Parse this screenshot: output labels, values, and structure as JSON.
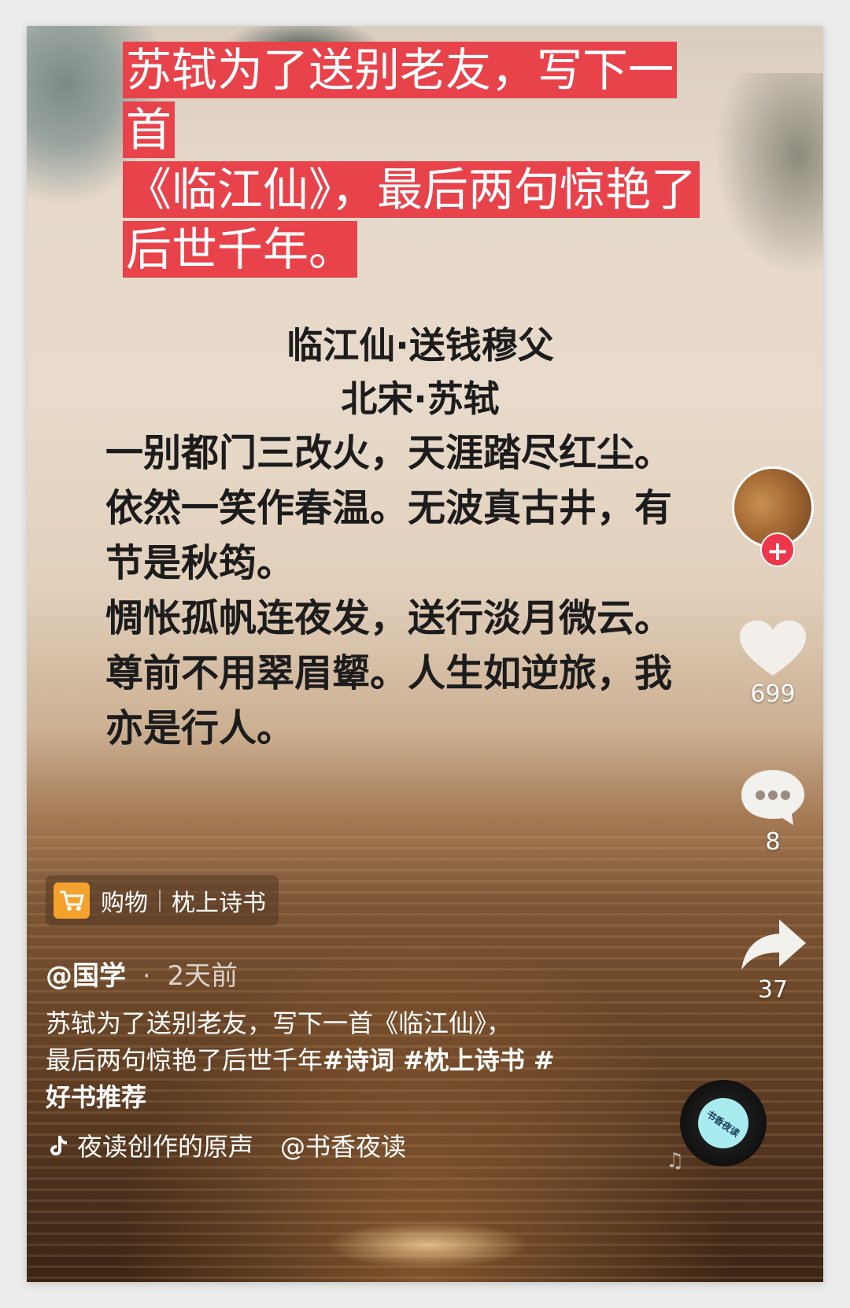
{
  "headline": {
    "line1": "苏轼为了送别老友，写下一首",
    "line2": "《临江仙》，最后两句惊艳了",
    "line3": "后世千年。"
  },
  "poem": {
    "title": "临江仙·送钱穆父",
    "author": "北宋·苏轼",
    "lines": [
      "一别都门三改火，天涯踏尽红尘。",
      "依然一笑作春温。无波真古井，有",
      "节是秋筠。",
      "惆怅孤帆连夜发，送行淡月微云。",
      "尊前不用翠眉颦。人生如逆旅，我",
      "亦是行人。"
    ]
  },
  "sidebar": {
    "follow_label": "+",
    "like_count": "699",
    "comment_count": "8",
    "share_count": "37"
  },
  "shop": {
    "label": "购物",
    "name": "枕上诗书"
  },
  "post": {
    "author": "@国学",
    "dot": "·",
    "time": "2天前",
    "caption_line1": "苏轼为了送别老友，写下一首《临江仙》，",
    "caption_line2_text": "最后两句惊艳了后世千年",
    "caption_line2_tags": "#诗词 #枕上诗书 #",
    "caption_line3": "好书推荐"
  },
  "music": {
    "source": "夜读创作的原声",
    "account": "@书香夜读",
    "disc_text": "书香夜读"
  },
  "colors": {
    "headline_bg": "#e8434b",
    "follow_btn": "#f0364c",
    "cart_bg": "#f4a22d",
    "disc_center": "#a9ecf0"
  }
}
